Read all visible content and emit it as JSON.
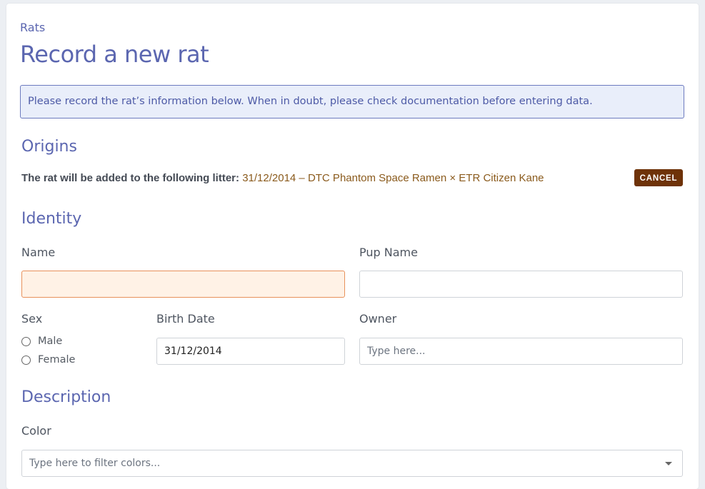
{
  "breadcrumb": "Rats",
  "page_title": "Record a new rat",
  "info_message": "Please record the rat’s information below. When in doubt, please check documentation before entering data.",
  "origins": {
    "heading": "Origins",
    "litter_label": "The rat will be added to the following litter:",
    "litter_value": "31/12/2014 – DTC Phantom Space Ramen × ETR Citizen Kane",
    "cancel_label": "CANCEL"
  },
  "identity": {
    "heading": "Identity",
    "name_label": "Name",
    "name_value": "",
    "pup_name_label": "Pup Name",
    "pup_name_value": "",
    "sex_label": "Sex",
    "sex_options": [
      "Male",
      "Female"
    ],
    "birth_date_label": "Birth Date",
    "birth_date_value": "31/12/2014",
    "owner_label": "Owner",
    "owner_placeholder": "Type here..."
  },
  "description": {
    "heading": "Description",
    "color_label": "Color",
    "color_placeholder": "Type here to filter colors..."
  },
  "colors": {
    "accent": "#5b66b0",
    "cancel_bg": "#6e3208",
    "litter_text": "#8a5a1c",
    "warning_bg": "#fff2e6",
    "warning_border": "#e8915b"
  }
}
